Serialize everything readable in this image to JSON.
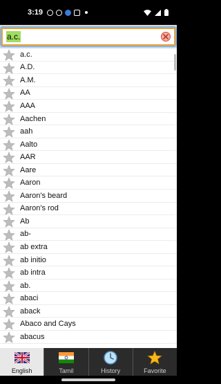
{
  "status_bar": {
    "time": "3:19"
  },
  "search": {
    "value": "a.c."
  },
  "words": [
    "a.c.",
    "A.D.",
    "A.M.",
    "AA",
    "AAA",
    "Aachen",
    "aah",
    "Aalto",
    "AAR",
    "Aare",
    "Aaron",
    "Aaron's beard",
    "Aaron's rod",
    "Ab",
    "ab-",
    "ab extra",
    "ab initio",
    "ab intra",
    "ab.",
    "abaci",
    "aback",
    "Abaco and Cays",
    "abacus"
  ],
  "tabs": [
    {
      "label": "English",
      "icon": "uk-flag-icon",
      "active": true
    },
    {
      "label": "Tamil",
      "icon": "india-flag-icon",
      "active": false
    },
    {
      "label": "History",
      "icon": "clock-icon",
      "active": false
    },
    {
      "label": "Favorite",
      "icon": "star-icon",
      "active": false
    }
  ],
  "colors": {
    "search_highlight": "#9fdc60",
    "search_border": "#f0a030",
    "tabbar_bg": "#2b2b2b"
  }
}
